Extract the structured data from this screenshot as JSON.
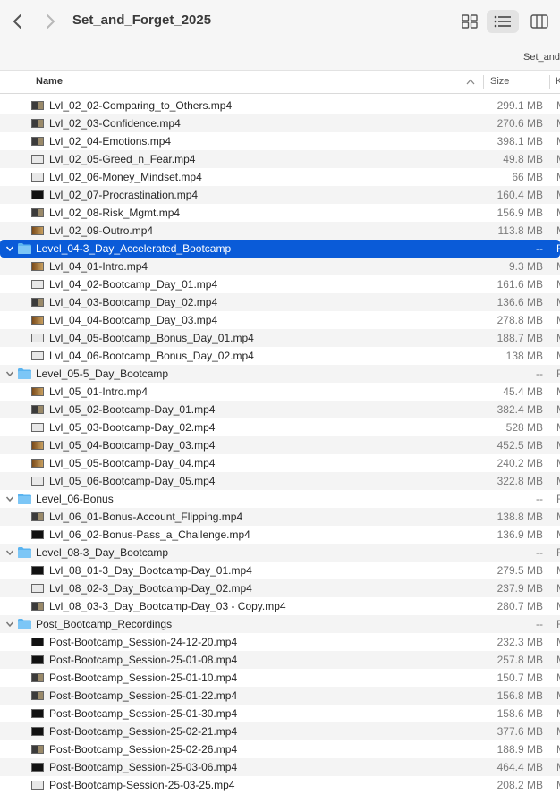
{
  "window": {
    "title": "Set_and_Forget_2025",
    "path_crumb": "Set_and"
  },
  "columns": {
    "name": "Name",
    "size": "Size",
    "kind": "K"
  },
  "rows": [
    {
      "type": "file",
      "name": "Lvl_02_02-Comparing_to_Others.mp4",
      "size": "299.1 MB",
      "kind": "M",
      "thumb": "mix"
    },
    {
      "type": "file",
      "name": "Lvl_02_03-Confidence.mp4",
      "size": "270.6 MB",
      "kind": "M",
      "thumb": "mix"
    },
    {
      "type": "file",
      "name": "Lvl_02_04-Emotions.mp4",
      "size": "398.1 MB",
      "kind": "M",
      "thumb": "mix"
    },
    {
      "type": "file",
      "name": "Lvl_02_05-Greed_n_Fear.mp4",
      "size": "49.8 MB",
      "kind": "M",
      "thumb": "light"
    },
    {
      "type": "file",
      "name": "Lvl_02_06-Money_Mindset.mp4",
      "size": "66 MB",
      "kind": "M",
      "thumb": "light"
    },
    {
      "type": "file",
      "name": "Lvl_02_07-Procrastination.mp4",
      "size": "160.4 MB",
      "kind": "M",
      "thumb": "dark"
    },
    {
      "type": "file",
      "name": "Lvl_02_08-Risk_Mgmt.mp4",
      "size": "156.9 MB",
      "kind": "M",
      "thumb": "mix"
    },
    {
      "type": "file",
      "name": "Lvl_02_09-Outro.mp4",
      "size": "113.8 MB",
      "kind": "M",
      "thumb": "warm"
    },
    {
      "type": "folder",
      "name": "Level_04-3_Day_Accelerated_Bootcamp",
      "size": "--",
      "kind": "F",
      "selected": true
    },
    {
      "type": "file",
      "name": "Lvl_04_01-Intro.mp4",
      "size": "9.3 MB",
      "kind": "M",
      "thumb": "warm"
    },
    {
      "type": "file",
      "name": "Lvl_04_02-Bootcamp_Day_01.mp4",
      "size": "161.6 MB",
      "kind": "M",
      "thumb": "light"
    },
    {
      "type": "file",
      "name": "Lvl_04_03-Bootcamp_Day_02.mp4",
      "size": "136.6 MB",
      "kind": "M",
      "thumb": "mix"
    },
    {
      "type": "file",
      "name": "Lvl_04_04-Bootcamp_Day_03.mp4",
      "size": "278.8 MB",
      "kind": "M",
      "thumb": "warm"
    },
    {
      "type": "file",
      "name": "Lvl_04_05-Bootcamp_Bonus_Day_01.mp4",
      "size": "188.7 MB",
      "kind": "M",
      "thumb": "light"
    },
    {
      "type": "file",
      "name": "Lvl_04_06-Bootcamp_Bonus_Day_02.mp4",
      "size": "138 MB",
      "kind": "M",
      "thumb": "light"
    },
    {
      "type": "folder",
      "name": "Level_05-5_Day_Bootcamp",
      "size": "--",
      "kind": "F"
    },
    {
      "type": "file",
      "name": "Lvl_05_01-Intro.mp4",
      "size": "45.4 MB",
      "kind": "M",
      "thumb": "warm"
    },
    {
      "type": "file",
      "name": "Lvl_05_02-Bootcamp-Day_01.mp4",
      "size": "382.4 MB",
      "kind": "M",
      "thumb": "mix"
    },
    {
      "type": "file",
      "name": "Lvl_05_03-Bootcamp-Day_02.mp4",
      "size": "528 MB",
      "kind": "M",
      "thumb": "light"
    },
    {
      "type": "file",
      "name": "Lvl_05_04-Bootcamp-Day_03.mp4",
      "size": "452.5 MB",
      "kind": "M",
      "thumb": "warm"
    },
    {
      "type": "file",
      "name": "Lvl_05_05-Bootcamp-Day_04.mp4",
      "size": "240.2 MB",
      "kind": "M",
      "thumb": "warm"
    },
    {
      "type": "file",
      "name": "Lvl_05_06-Bootcamp-Day_05.mp4",
      "size": "322.8 MB",
      "kind": "M",
      "thumb": "light"
    },
    {
      "type": "folder",
      "name": "Level_06-Bonus",
      "size": "--",
      "kind": "F"
    },
    {
      "type": "file",
      "name": "Lvl_06_01-Bonus-Account_Flipping.mp4",
      "size": "138.8 MB",
      "kind": "M",
      "thumb": "mix"
    },
    {
      "type": "file",
      "name": "Lvl_06_02-Bonus-Pass_a_Challenge.mp4",
      "size": "136.9 MB",
      "kind": "M",
      "thumb": "dark"
    },
    {
      "type": "folder",
      "name": "Level_08-3_Day_Bootcamp",
      "size": "--",
      "kind": "F"
    },
    {
      "type": "file",
      "name": "Lvl_08_01-3_Day_Bootcamp-Day_01.mp4",
      "size": "279.5 MB",
      "kind": "M",
      "thumb": "dark"
    },
    {
      "type": "file",
      "name": "Lvl_08_02-3_Day_Bootcamp-Day_02.mp4",
      "size": "237.9 MB",
      "kind": "M",
      "thumb": "light"
    },
    {
      "type": "file",
      "name": "Lvl_08_03-3_Day_Bootcamp-Day_03 - Copy.mp4",
      "size": "280.7 MB",
      "kind": "M",
      "thumb": "mix"
    },
    {
      "type": "folder",
      "name": "Post_Bootcamp_Recordings",
      "size": "--",
      "kind": "F"
    },
    {
      "type": "file",
      "name": "Post-Bootcamp_Session-24-12-20.mp4",
      "size": "232.3 MB",
      "kind": "M",
      "thumb": "dark"
    },
    {
      "type": "file",
      "name": "Post-Bootcamp_Session-25-01-08.mp4",
      "size": "257.8 MB",
      "kind": "M",
      "thumb": "dark"
    },
    {
      "type": "file",
      "name": "Post-Bootcamp_Session-25-01-10.mp4",
      "size": "150.7 MB",
      "kind": "M",
      "thumb": "mix"
    },
    {
      "type": "file",
      "name": "Post-Bootcamp_Session-25-01-22.mp4",
      "size": "156.8 MB",
      "kind": "M",
      "thumb": "mix"
    },
    {
      "type": "file",
      "name": "Post-Bootcamp_Session-25-01-30.mp4",
      "size": "158.6 MB",
      "kind": "M",
      "thumb": "dark"
    },
    {
      "type": "file",
      "name": "Post-Bootcamp_Session-25-02-21.mp4",
      "size": "377.6 MB",
      "kind": "M",
      "thumb": "dark"
    },
    {
      "type": "file",
      "name": "Post-Bootcamp_Session-25-02-26.mp4",
      "size": "188.9 MB",
      "kind": "M",
      "thumb": "mix"
    },
    {
      "type": "file",
      "name": "Post-Bootcamp_Session-25-03-06.mp4",
      "size": "464.4 MB",
      "kind": "M",
      "thumb": "dark"
    },
    {
      "type": "file",
      "name": "Post-Bootcamp-Session-25-03-25.mp4",
      "size": "208.2 MB",
      "kind": "M",
      "thumb": "light"
    }
  ],
  "colors": {
    "selection": "#0a5bd8",
    "folder": "#5ab4f0",
    "toolbar_bg": "#f6f6f6"
  }
}
